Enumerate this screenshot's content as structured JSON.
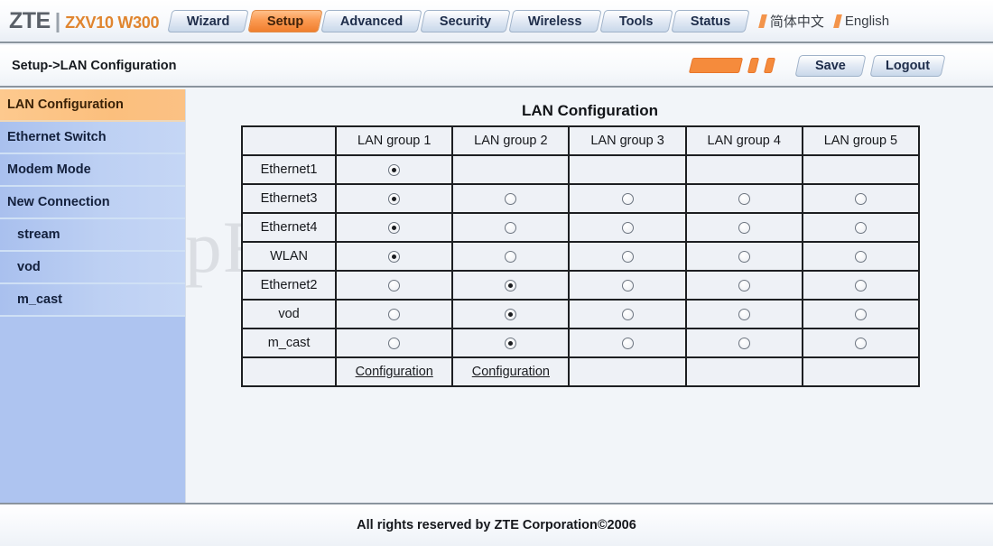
{
  "header": {
    "brand_name": "ZTE",
    "brand_separator": "|",
    "brand_model": "ZXV10 W300",
    "tabs": [
      {
        "label": "Wizard",
        "active": false
      },
      {
        "label": "Setup",
        "active": true
      },
      {
        "label": "Advanced",
        "active": false
      },
      {
        "label": "Security",
        "active": false
      },
      {
        "label": "Wireless",
        "active": false
      },
      {
        "label": "Tools",
        "active": false
      },
      {
        "label": "Status",
        "active": false
      }
    ],
    "languages": [
      {
        "label": "简体中文"
      },
      {
        "label": "English"
      }
    ]
  },
  "crumbbar": {
    "breadcrumb": "Setup->LAN Configuration",
    "save_label": "Save",
    "logout_label": "Logout"
  },
  "sidebar": {
    "items": [
      {
        "label": "LAN Configuration",
        "active": true,
        "child": false
      },
      {
        "label": "Ethernet Switch",
        "active": false,
        "child": false
      },
      {
        "label": "Modem Mode",
        "active": false,
        "child": false
      },
      {
        "label": "New Connection",
        "active": false,
        "child": false
      },
      {
        "label": "stream",
        "active": false,
        "child": true
      },
      {
        "label": "vod",
        "active": false,
        "child": true
      },
      {
        "label": "m_cast",
        "active": false,
        "child": true
      }
    ]
  },
  "main": {
    "panel_title": "LAN Configuration",
    "watermark": "SetupRouter.com",
    "table": {
      "corner_header": "",
      "columns": [
        "LAN group 1",
        "LAN group 2",
        "LAN group 3",
        "LAN group 4",
        "LAN group 5"
      ],
      "rows": [
        {
          "label": "Ethernet1",
          "cells": [
            "selected",
            "none",
            "none",
            "none",
            "none"
          ]
        },
        {
          "label": "Ethernet3",
          "cells": [
            "selected",
            "unselected",
            "unselected",
            "unselected",
            "unselected"
          ]
        },
        {
          "label": "Ethernet4",
          "cells": [
            "selected",
            "unselected",
            "unselected",
            "unselected",
            "unselected"
          ]
        },
        {
          "label": "WLAN",
          "cells": [
            "selected",
            "unselected",
            "unselected",
            "unselected",
            "unselected"
          ]
        },
        {
          "label": "Ethernet2",
          "cells": [
            "unselected",
            "selected",
            "unselected",
            "unselected",
            "unselected"
          ]
        },
        {
          "label": "vod",
          "cells": [
            "unselected",
            "selected",
            "unselected",
            "unselected",
            "unselected"
          ]
        },
        {
          "label": "m_cast",
          "cells": [
            "unselected",
            "selected",
            "unselected",
            "unselected",
            "unselected"
          ]
        }
      ],
      "footer_row": {
        "label": "",
        "links": [
          "Configuration",
          "Configuration",
          "",
          "",
          ""
        ]
      }
    }
  },
  "footer": {
    "text": "All rights reserved by ZTE Corporation©2006"
  },
  "colors": {
    "accent_orange": "#f58b3c",
    "tab_blue": "#c9d8ea",
    "sidebar_blue": "#aec4f0",
    "sidebar_active": "#fbbf7d",
    "text_dark": "#16181c"
  }
}
